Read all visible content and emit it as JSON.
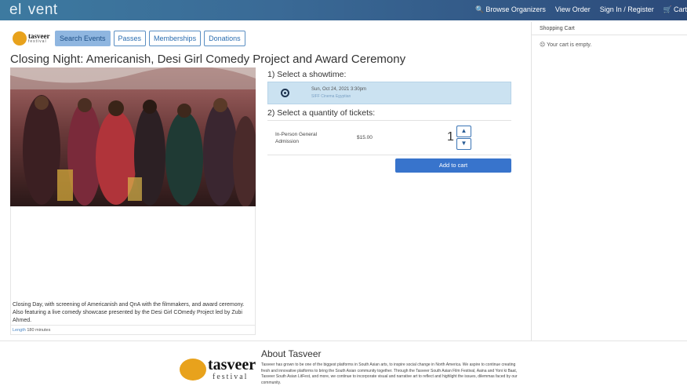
{
  "header": {
    "brand": "el vent",
    "brand_left": "el",
    "brand_right": "vent",
    "nav": {
      "browse": "Browse Organizers",
      "view_order": "View Order",
      "sign_in": "Sign In / Register",
      "cart": "Cart"
    },
    "icons": {
      "search": "search-icon",
      "cart": "cart-icon"
    }
  },
  "org_logo": {
    "name": "tasveer",
    "sub": "festival"
  },
  "tabs": [
    {
      "label": "Search Events",
      "active": true
    },
    {
      "label": "Passes",
      "active": false
    },
    {
      "label": "Memberships",
      "active": false
    },
    {
      "label": "Donations",
      "active": false
    }
  ],
  "event": {
    "title": "Closing Night: Americanish, Desi Girl Comedy Project and Award Ceremony",
    "description": "Closing Day, with screening of Americanish and QnA with the filmmakers, and award ceremony. Also featuring a live comedy showcase presented by the Desi Girl COmedy Project led by Zubi Ahmed.",
    "length_label": "Length",
    "length_value": "180 minutes"
  },
  "showtime": {
    "heading": "1) Select a showtime:",
    "date": "Sun, Oct 24, 2021 3:30pm",
    "venue": "SIFF Cinema Egyptian"
  },
  "tickets": {
    "heading": "2) Select a quantity of tickets:",
    "items": [
      {
        "name": "In-Person General Admission",
        "price": "$15.00",
        "quantity": "1"
      }
    ],
    "add_to_cart": "Add to cart"
  },
  "cart": {
    "heading": "Shopping Cart",
    "empty_text": "Your cart is empty."
  },
  "footer": {
    "logo_name": "tasveer",
    "logo_sub": "festival",
    "about_title": "About Tasveer",
    "about_text": "Tasveer has grown to be one of the biggest platforms in South Asian arts, to inspire social change in North America. We aspire to continue creating fresh and innovative platforms to bring the South Asian community together. Through the Tasveer South Asian Film Festival, Aaina and Yoni ki Baat, Tasveer South Asian LitFest, and more, we continue to incorporate visual and narrative art to reflect and highlight the issues, dilemmas faced by our community."
  },
  "colors": {
    "header_start": "#3d7aa0",
    "header_end": "#2c4a7a",
    "accent_blue": "#3874cc",
    "showtime_bg": "#cbe2f1",
    "logo_orange": "#e8a21c"
  }
}
